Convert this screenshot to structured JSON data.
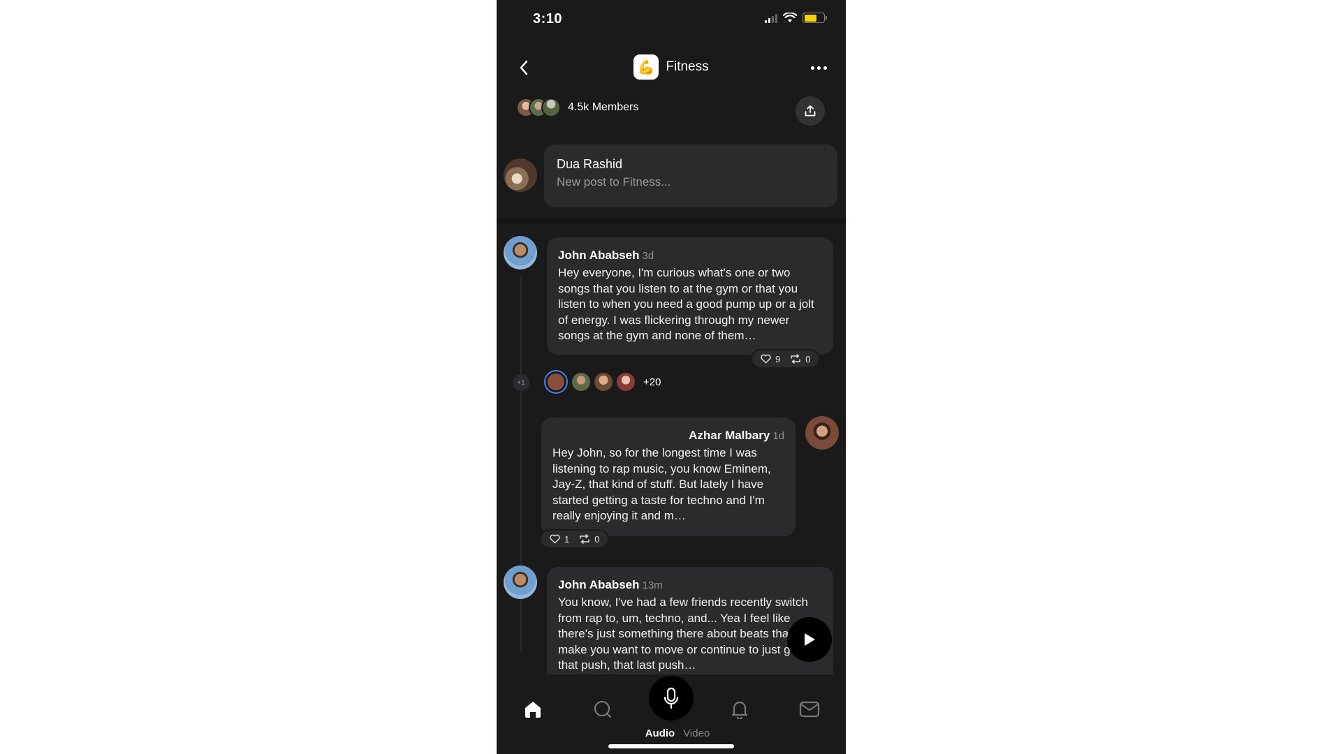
{
  "status_bar": {
    "time": "3:10"
  },
  "header": {
    "title": "Fitness",
    "app_icon": "💪"
  },
  "members": {
    "label": "4.5k Members"
  },
  "composer": {
    "name": "Dua Rashid",
    "placeholder": "New post to Fitness..."
  },
  "posts": [
    {
      "author": "John Ababseh",
      "time": "3d",
      "text": "Hey everyone, I'm curious what's one or two songs that you listen to at the gym or that you listen to when you need a good pump up or a jolt of energy. I was flickering through my newer songs at the gym and none of them…",
      "likes": "9",
      "reposts": "0"
    },
    {
      "author": "Azhar Malbary",
      "time": "1d",
      "text": "Hey John, so for the longest time I was listening to rap music, you know Eminem, Jay-Z, that kind of stuff. But lately I have started getting a taste for techno and I'm really enjoying it and m…",
      "likes": "1",
      "reposts": "0"
    },
    {
      "author": "John Ababseh",
      "time": "13m",
      "text": "You know, I've had a few friends recently switch from rap to, um, techno, and... Yea I feel like there's just something there about beats that just make you want to move or continue to just get that push, that last push…"
    }
  ],
  "thread": {
    "plus_one": "+1",
    "repliers_more": "+20"
  },
  "tabbar": {
    "mode_audio": "Audio",
    "mode_video": "Video"
  },
  "colors": {
    "background": "#1a1a1a",
    "bubble": "#2b2b2d",
    "accent_ring": "#3b82f6",
    "battery": "#f4d10b"
  },
  "icons": [
    "back-icon",
    "more-icon",
    "share-icon",
    "heart-icon",
    "repost-icon",
    "play-icon",
    "home-icon",
    "search-icon",
    "mic-icon",
    "bell-icon",
    "mail-icon"
  ]
}
